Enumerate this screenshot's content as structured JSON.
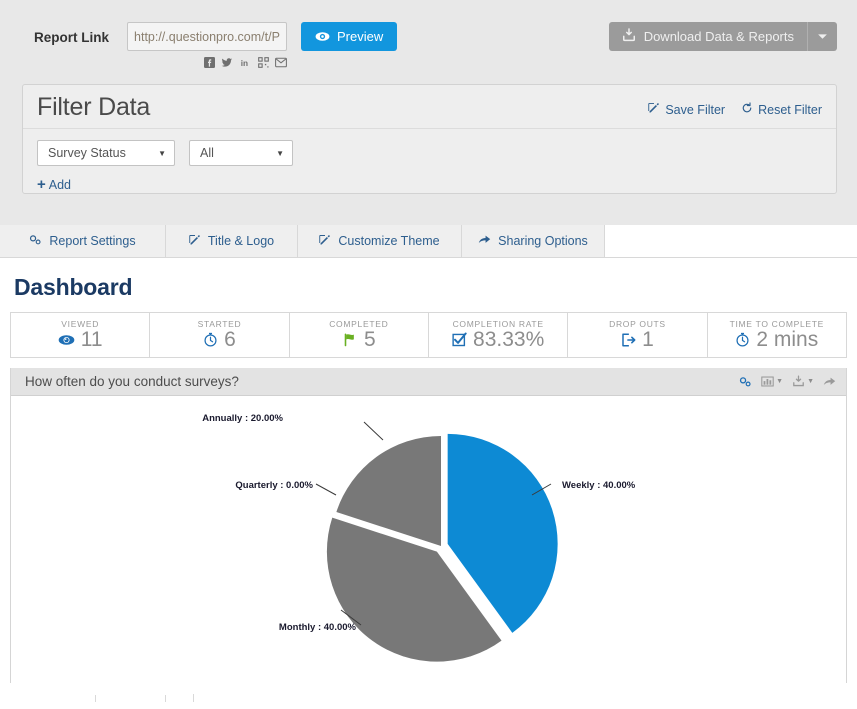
{
  "topbar": {
    "report_link_label": "Report Link",
    "report_link_value": "http://.questionpro.com/t/P",
    "report_link_placeholder": "http://.questionpro.com/t/P",
    "preview_label": "Preview",
    "download_label": "Download Data & Reports",
    "social": [
      {
        "name": "facebook-icon",
        "label": "Facebook"
      },
      {
        "name": "twitter-icon",
        "label": "Twitter"
      },
      {
        "name": "linkedin-icon",
        "label": "LinkedIn"
      },
      {
        "name": "qrcode-icon",
        "label": "QR Code"
      },
      {
        "name": "email-icon",
        "label": "Email"
      }
    ]
  },
  "filter": {
    "title": "Filter Data",
    "save_label": "Save Filter",
    "reset_label": "Reset Filter",
    "add_label": "Add",
    "selects": [
      {
        "name": "filter-field-select",
        "value": "Survey Status"
      },
      {
        "name": "filter-value-select",
        "value": "All"
      }
    ]
  },
  "tabs": [
    {
      "label": "Report Settings",
      "icon": "gears-icon"
    },
    {
      "label": "Title & Logo",
      "icon": "edit-icon"
    },
    {
      "label": "Customize Theme",
      "icon": "edit-icon"
    },
    {
      "label": "Sharing Options",
      "icon": "share-icon"
    }
  ],
  "dashboard": {
    "title": "Dashboard",
    "stats": [
      {
        "label": "VIEWED",
        "value": "11",
        "icon": "eye-icon"
      },
      {
        "label": "STARTED",
        "value": "6",
        "icon": "stopwatch-icon"
      },
      {
        "label": "COMPLETED",
        "value": "5",
        "icon": "flag-icon"
      },
      {
        "label": "COMPLETION RATE",
        "value": "83.33%",
        "icon": "check-box-icon"
      },
      {
        "label": "DROP OUTS",
        "value": "1",
        "icon": "exit-icon"
      },
      {
        "label": "TIME TO COMPLETE",
        "value": "2 mins",
        "icon": "stopwatch-icon"
      }
    ]
  },
  "chart_panel": {
    "question": "How often do you conduct surveys?",
    "tools": [
      {
        "name": "chart-settings-icon",
        "caret": false
      },
      {
        "name": "chart-type-icon",
        "caret": true
      },
      {
        "name": "chart-download-icon",
        "caret": true
      },
      {
        "name": "chart-share-icon",
        "caret": false
      }
    ]
  },
  "chart_data": {
    "type": "pie",
    "title": "How often do you conduct surveys?",
    "categories": [
      "Weekly",
      "Monthly",
      "Annually",
      "Quarterly"
    ],
    "values": [
      40.0,
      40.0,
      20.0,
      0.0
    ],
    "value_unit": "%",
    "labels": [
      "Weekly : 40.00%",
      "Monthly : 40.00%",
      "Annually : 20.00%",
      "Quarterly : 0.00%"
    ],
    "colors": [
      "#0d8ad4",
      "#787878",
      "#787878",
      "#787878"
    ],
    "exploded": [
      "Weekly",
      "Monthly"
    ],
    "legend": "none",
    "grid": false,
    "xlabel": "",
    "ylabel": ""
  },
  "colors": {
    "accent_blue": "#1296de",
    "pie_blue": "#0d8ad4",
    "pie_gray": "#787878",
    "link_blue": "#2d5e8e",
    "heading_navy": "#1b3a63",
    "panel_gray": "#e8e8e8"
  }
}
